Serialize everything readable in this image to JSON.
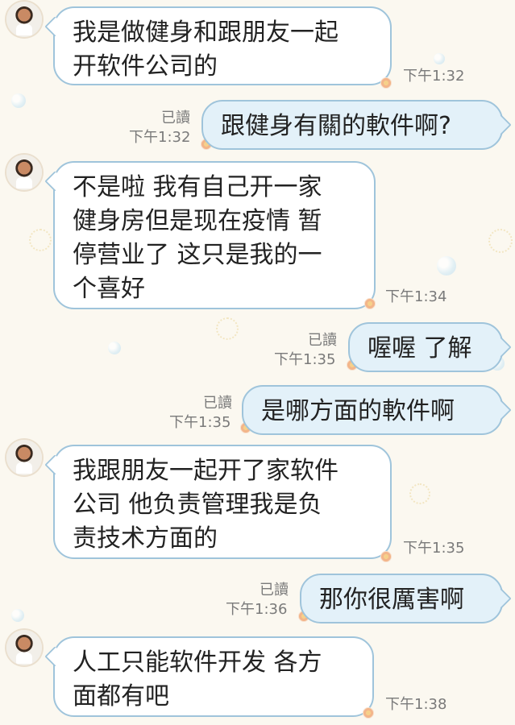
{
  "messages": [
    {
      "side": "in",
      "text": "我是做健身和跟朋友一起\n开软件公司的",
      "time": "下午1:32"
    },
    {
      "side": "out",
      "text": "跟健身有關的軟件啊?",
      "read": "已讀",
      "time": "下午1:32"
    },
    {
      "side": "in",
      "text": "不是啦 我有自己开一家\n健身房但是现在疫情 暂\n停营业了 这只是我的一\n个喜好",
      "time": "下午1:34"
    },
    {
      "side": "out",
      "text": "喔喔 了解",
      "read": "已讀",
      "time": "下午1:35"
    },
    {
      "side": "out",
      "text": "是哪方面的軟件啊",
      "read": "已讀",
      "time": "下午1:35"
    },
    {
      "side": "in",
      "text": "我跟朋友一起开了家软件\n公司 他负责管理我是负\n责技术方面的",
      "time": "下午1:35"
    },
    {
      "side": "out",
      "text": "那你很厲害啊",
      "read": "已讀",
      "time": "下午1:36"
    },
    {
      "side": "in",
      "text": "人工只能软件开发 各方\n面都有吧",
      "time": "下午1:38"
    }
  ],
  "colors": {
    "bubble_border": "#9fc4db",
    "bubble_out": "#e3f1f9",
    "bubble_in": "#ffffff",
    "background": "#fbf8f0"
  },
  "icons": {
    "avatar": "avatar-icon",
    "tail": "flower-icon"
  }
}
